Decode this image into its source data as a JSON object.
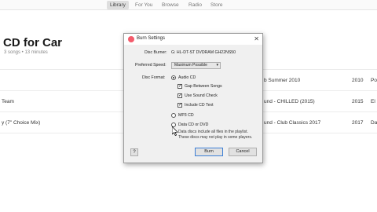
{
  "nav": {
    "tabs": [
      {
        "label": "Library",
        "active": true
      },
      {
        "label": "For You"
      },
      {
        "label": "Browse"
      },
      {
        "label": "Radio"
      },
      {
        "label": "Store"
      }
    ]
  },
  "album": {
    "title": "CD for Car",
    "subtitle": "3 songs • 13 minutes"
  },
  "tracks": [
    {
      "name": "",
      "album": "b Summer 2010",
      "year": "2010",
      "genre": "Po"
    },
    {
      "name": "Team",
      "album": "und - CHILLED (2015)",
      "year": "2015",
      "genre": "El"
    },
    {
      "name": "y (7\" Choice Mix)",
      "album": "und - Club Classics 2017",
      "year": "2017",
      "genre": "Da"
    }
  ],
  "dialog": {
    "title": "Burn Settings",
    "disc_burner_label": "Disc Burner:",
    "disc_burner_value": "G: HL-DT-ST DVDRAM GH22NS50",
    "speed_label": "Preferred Speed:",
    "speed_value": "Maximum Possible",
    "format_label": "Disc Format:",
    "audio_cd": "Audio CD",
    "gap_between_songs": "Gap Between Songs",
    "use_sound_check": "Use Sound Check",
    "include_cd_text": "Include CD Text",
    "mp3_cd": "MP3 CD",
    "data_cd": "Data CD or DVD",
    "data_note_line1": "Data discs include all files in the playlist.",
    "data_note_line2": "These discs may not play in some players.",
    "help": "?",
    "burn": "Burn",
    "cancel": "Cancel",
    "close": "✕"
  },
  "colors": {
    "dialog_icon": "#f45b6b",
    "primary_border": "#3c7fd6"
  }
}
